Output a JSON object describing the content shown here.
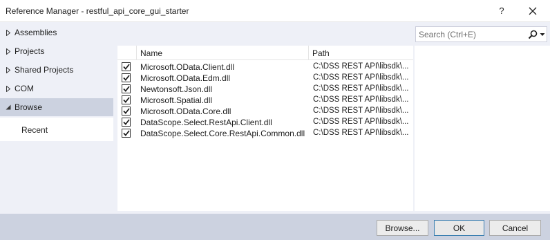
{
  "window": {
    "title": "Reference Manager - restful_api_core_gui_starter",
    "help_label": "?"
  },
  "nav": {
    "items": [
      {
        "label": "Assemblies",
        "expanded": false
      },
      {
        "label": "Projects",
        "expanded": false
      },
      {
        "label": "Shared Projects",
        "expanded": false
      },
      {
        "label": "COM",
        "expanded": false
      },
      {
        "label": "Browse",
        "expanded": true,
        "selected": true
      }
    ],
    "sub_items": [
      {
        "label": "Recent"
      }
    ]
  },
  "search": {
    "placeholder": "Search (Ctrl+E)",
    "value": "",
    "icon": "search-icon"
  },
  "list": {
    "columns": [
      "Name",
      "Path"
    ],
    "rows": [
      {
        "checked": true,
        "name": "Microsoft.OData.Client.dll",
        "path": "C:\\DSS REST API\\libsdk\\..."
      },
      {
        "checked": true,
        "name": "Microsoft.OData.Edm.dll",
        "path": "C:\\DSS REST API\\libsdk\\..."
      },
      {
        "checked": true,
        "name": "Newtonsoft.Json.dll",
        "path": "C:\\DSS REST API\\libsdk\\..."
      },
      {
        "checked": true,
        "name": "Microsoft.Spatial.dll",
        "path": "C:\\DSS REST API\\libsdk\\..."
      },
      {
        "checked": true,
        "name": "Microsoft.OData.Core.dll",
        "path": "C:\\DSS REST API\\libsdk\\..."
      },
      {
        "checked": true,
        "name": "DataScope.Select.RestApi.Client.dll",
        "path": "C:\\DSS REST API\\libsdk\\..."
      },
      {
        "checked": true,
        "name": "DataScope.Select.Core.RestApi.Common.dll",
        "path": "C:\\DSS REST API\\libsdk\\..."
      }
    ]
  },
  "footer": {
    "browse_label": "Browse...",
    "ok_label": "OK",
    "cancel_label": "Cancel"
  },
  "colors": {
    "panel_bg": "#eef0f7",
    "selected_bg": "#ccd2e0",
    "footer_bg": "#ccd2e0",
    "ok_border": "#3c7fb1"
  }
}
